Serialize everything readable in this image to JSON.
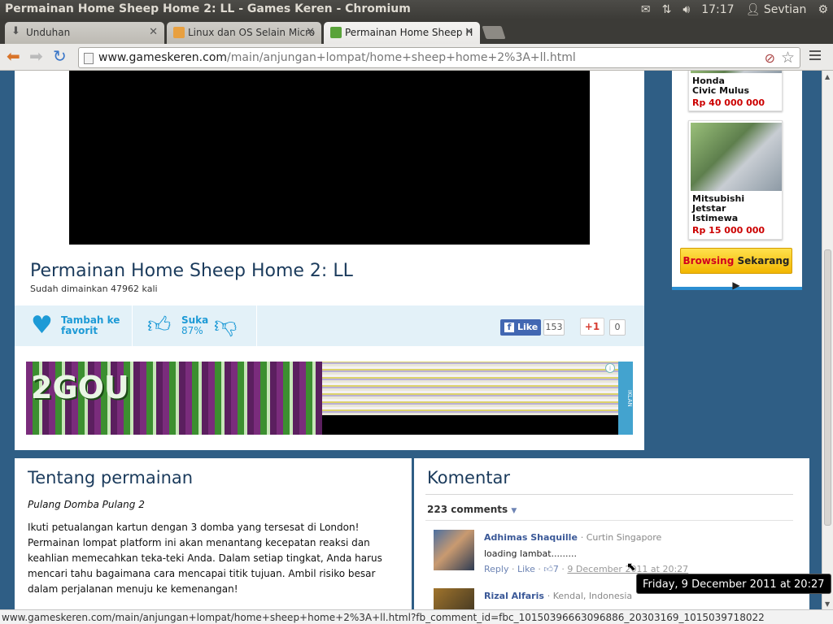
{
  "window": {
    "title": "Permainan Home Sheep Home 2: LL - Games Keren - Chromium"
  },
  "tray": {
    "clock": "17:17",
    "user": "Sevtian",
    "icons": [
      "mail-icon",
      "network-icon",
      "volume-icon",
      "user-icon",
      "gear-icon"
    ]
  },
  "tabs": [
    {
      "label": "Unduhan",
      "icon": "download-icon"
    },
    {
      "label": "Linux dan OS Selain Micro",
      "icon": "site-favicon"
    },
    {
      "label": "Permainan Home Sheep H",
      "icon": "gameskeren-favicon",
      "active": true
    }
  ],
  "address": {
    "domain": "www.gameskeren.com",
    "path": "/main/anjungan+lompat/home+sheep+home+2%3A+ll.html"
  },
  "game": {
    "title": "Permainan Home Sheep Home 2: LL",
    "played": "Sudah dimainkan 47962 kali"
  },
  "actions": {
    "favorite": "Tambah ke favorit",
    "like_label": "Suka",
    "like_percent": "87%",
    "fb_like": "Like",
    "fb_count": "153",
    "gplus": "+1",
    "gplus_count": "0"
  },
  "ad_banner": {
    "logo": "2GOU",
    "tag": "IKLAN"
  },
  "right_ads": {
    "cars": [
      {
        "name": "Honda Civic Mulus",
        "price": "Rp 40 000 000"
      },
      {
        "name": "Mitsubishi Jetstar Istimewa",
        "price": "Rp 15 000 000"
      }
    ],
    "browse_red": "Browsing",
    "browse_rest": "Sekarang ▶"
  },
  "about": {
    "heading": "Tentang permainan",
    "subtitle": "Pulang Domba Pulang 2",
    "text": "Ikuti petualangan kartun dengan 3 domba yang tersesat di London! Permainan lompat platform ini akan menantang kecepatan reaksi dan keahlian memecahkan teka-teki Anda. Dalam setiap tingkat, Anda harus mencari tahu bagaimana cara mencapai titik tujuan. Ambil risiko besar dalam perjalanan menuju ke kemenangan!"
  },
  "comments": {
    "heading": "Komentar",
    "count": "223 comments",
    "items": [
      {
        "name": "Adhimas Shaquille",
        "location": "· Curtin Singapore",
        "text": "loading lambat.........",
        "reply": "Reply",
        "like": "Like",
        "likes": "7",
        "date": "9 December 2011 at 20:27"
      },
      {
        "name": "Rizal Alfaris",
        "location": "· Kendal, Indonesia"
      }
    ]
  },
  "tooltip": "Friday, 9 December 2011 at 20:27",
  "status_url": "www.gameskeren.com/main/anjungan+lompat/home+sheep+home+2%3A+ll.html?fb_comment_id=fbc_10150396663096886_20303169_1015039718022"
}
